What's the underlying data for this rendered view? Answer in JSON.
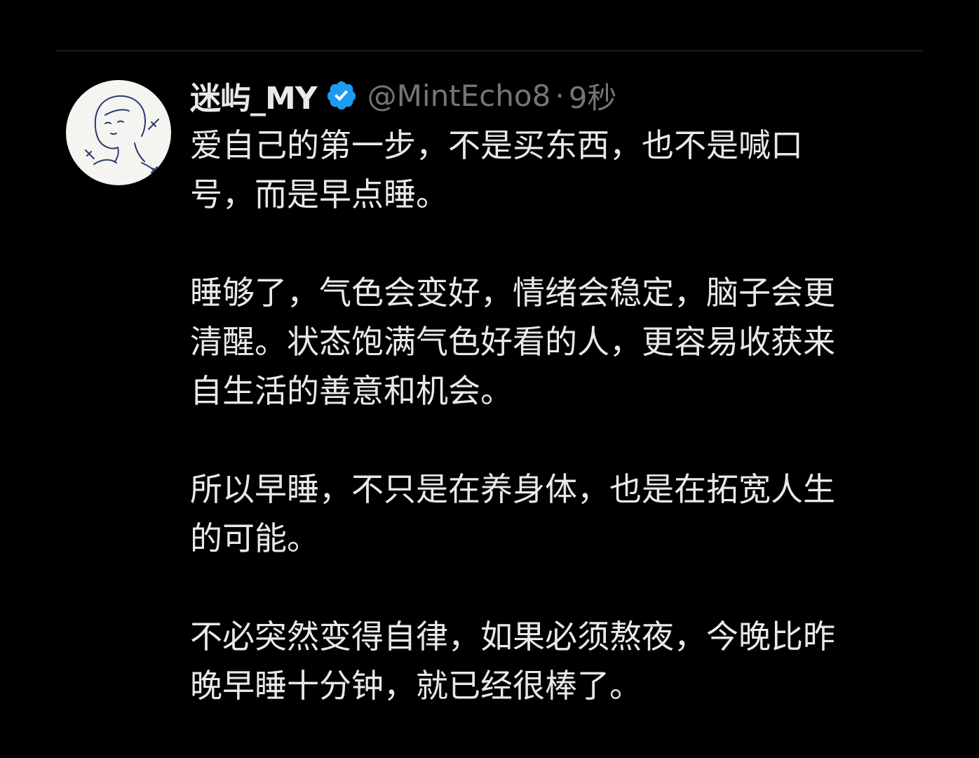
{
  "tweet": {
    "display_name": "迷屿_MY",
    "handle": "@MintEcho8",
    "separator": "·",
    "time": "9秒",
    "colors": {
      "background": "#000000",
      "verified_badge": "#1d9bf0",
      "text": "#e7e9ea",
      "secondary_text": "#71767b"
    },
    "icons": {
      "verified": "verified-badge-icon",
      "avatar": "line-drawing-portrait"
    },
    "paragraphs": [
      {
        "lines": [
          "爱自己的第一步，不是买东西，也不是喊口",
          "号，而是早点睡。"
        ]
      },
      {
        "lines": [
          "睡够了，气色会变好，情绪会稳定，脑子会更",
          "清醒。状态饱满气色好看的人，更容易收获来",
          "自生活的善意和机会。"
        ]
      },
      {
        "lines": [
          "所以早睡，不只是在养身体，也是在拓宽人生",
          "的可能。"
        ]
      },
      {
        "lines": [
          "不必突然变得自律，如果必须熬夜，今晚比昨",
          "晚早睡十分钟，就已经很棒了。"
        ]
      }
    ]
  }
}
